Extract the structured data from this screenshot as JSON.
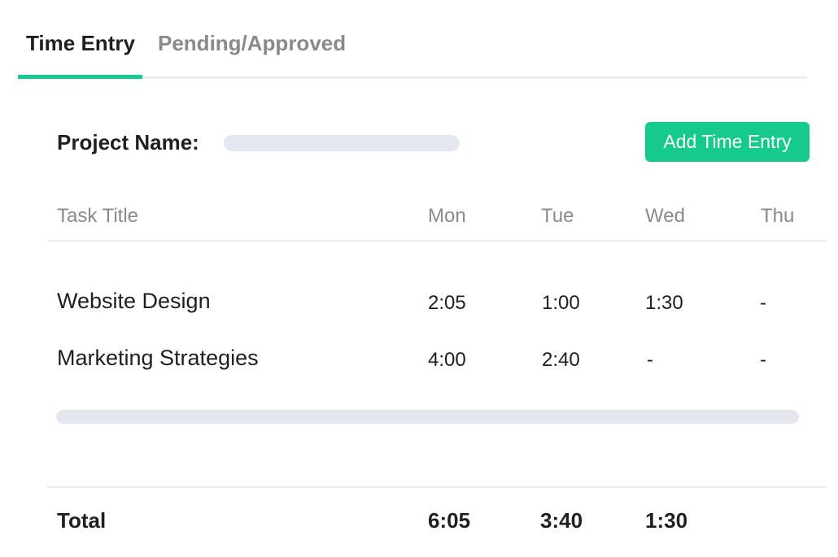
{
  "tabs": [
    {
      "label": "Time Entry",
      "active": true
    },
    {
      "label": "Pending/Approved",
      "active": false
    }
  ],
  "project": {
    "label": "Project Name:",
    "add_button_label": "Add Time Entry"
  },
  "table": {
    "headers": [
      "Task Title",
      "Mon",
      "Tue",
      "Wed",
      "Thu"
    ],
    "rows": [
      {
        "task": "Website Design",
        "mon": "2:05",
        "tue": "1:00",
        "wed": "1:30",
        "thu": "-"
      },
      {
        "task": "Marketing Strategies",
        "mon": "4:00",
        "tue": "2:40",
        "wed": "-",
        "thu": "-"
      }
    ],
    "total": {
      "label": "Total",
      "mon": "6:05",
      "tue": "3:40",
      "wed": "1:30"
    }
  },
  "colors": {
    "accent": "#16c98d",
    "placeholder": "#e4e8ee",
    "muted_text": "#8a8a8a",
    "text": "#1f1f1f"
  }
}
